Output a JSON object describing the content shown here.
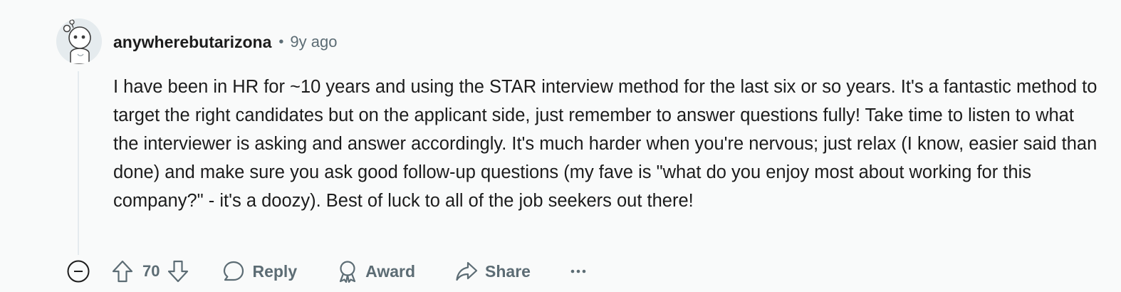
{
  "comment": {
    "author": "anywherebutarizona",
    "separator": "•",
    "timestamp": "9y ago",
    "body": "I have been in HR for ~10 years and using the STAR interview method for the last six or so years. It's a fantastic method to target the right candidates but on the applicant side, just remember to answer questions fully! Take time to listen to what the interviewer is asking and answer accordingly. It's much harder when you're nervous; just relax (I know, easier said than done) and make sure you ask good follow-up questions (my fave is \"what do you enjoy most about working for this company?\" - it's a doozy). Best of luck to all of the job seekers out there!",
    "avatar_icon": "snoo-avatar-icon"
  },
  "actions": {
    "collapse_icon": "collapse-minus-icon",
    "upvote_icon": "arrow-up-icon",
    "score": "70",
    "downvote_icon": "arrow-down-icon",
    "reply_label": "Reply",
    "reply_icon": "speech-bubble-icon",
    "award_label": "Award",
    "award_icon": "award-ribbon-icon",
    "share_label": "Share",
    "share_icon": "share-arrow-icon",
    "more_label": "···"
  },
  "colors": {
    "background": "#f9fafa",
    "text": "#1c1c1c",
    "secondary_text": "#5c6c74",
    "thread_line": "#e5ebee"
  }
}
